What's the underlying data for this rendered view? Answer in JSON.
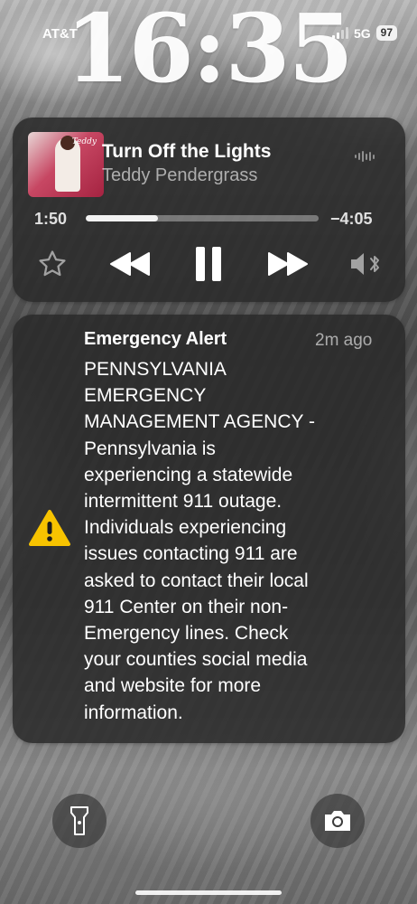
{
  "status_bar": {
    "carrier": "AT&T",
    "network": "5G",
    "battery": "97"
  },
  "lock_screen": {
    "time": "16:35"
  },
  "now_playing": {
    "title": "Turn Off the Lights",
    "artist": "Teddy Pendergrass",
    "album_art_text": "Teddy",
    "elapsed": "1:50",
    "remaining": "−4:05",
    "progress_fraction": 0.31,
    "controls": {
      "favorite_icon": "star-icon",
      "rewind_icon": "rewind-icon",
      "pause_icon": "pause-icon",
      "forward_icon": "fast-forward-icon",
      "output_icon": "speaker-bluetooth-icon"
    }
  },
  "notification": {
    "title": "Emergency Alert",
    "time": "2m ago",
    "icon": "warning-icon",
    "accent_color": "#F7C300",
    "body": "PENNSYLVANIA\nEMERGENCY\nMANAGEMENT AGENCY -\nPennsylvania is\nexperiencing a statewide\nintermittent 911 outage.\nIndividuals experiencing\nissues contacting 911 are\nasked to contact their local\n911 Center on their non-\nEmergency lines.  Check\nyour counties social media\nand website for more\ninformation."
  },
  "quick_actions": {
    "left_icon": "flashlight-icon",
    "right_icon": "camera-icon"
  }
}
